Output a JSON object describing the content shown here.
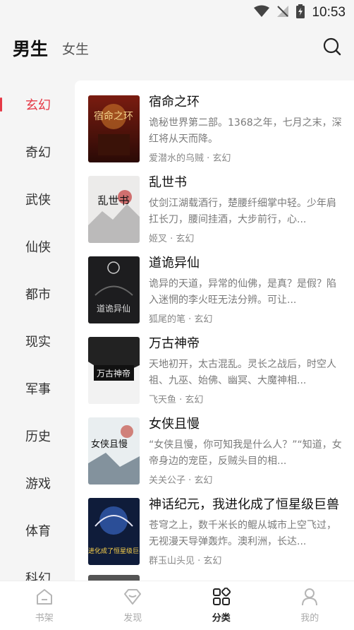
{
  "status_bar": {
    "time": "10:53"
  },
  "header": {
    "tab_active": "男生",
    "tab_inactive": "女生"
  },
  "sidebar": {
    "items": [
      {
        "label": "玄幻",
        "active": true
      },
      {
        "label": "奇幻"
      },
      {
        "label": "武侠"
      },
      {
        "label": "仙侠"
      },
      {
        "label": "都市"
      },
      {
        "label": "现实"
      },
      {
        "label": "军事"
      },
      {
        "label": "历史"
      },
      {
        "label": "游戏"
      },
      {
        "label": "体育"
      },
      {
        "label": "科幻"
      }
    ]
  },
  "books": [
    {
      "title": "宿命之环",
      "desc": "诡秘世界第二部。1368之年，七月之末，深红将从天而降。",
      "author": "爱潜水的乌贼",
      "genre": "玄幻",
      "cover_text": "宿命之环"
    },
    {
      "title": "乱世书",
      "desc": "仗剑江湖载酒行，楚腰纤细掌中轻。少年肩扛长刀，腰间挂酒，大步前行，心...",
      "author": "姬叉",
      "genre": "玄幻",
      "cover_text": "乱世书"
    },
    {
      "title": "道诡异仙",
      "desc": "诡异的天道，异常的仙佛，是真？是假？陷入迷惘的李火旺无法分辨。可让...",
      "author": "狐尾的笔",
      "genre": "玄幻",
      "cover_text": "道诡异仙"
    },
    {
      "title": "万古神帝",
      "desc": "天地初开，太古混乱。灵长之战后，时空人祖、九巫、始佛、幽冥、大魔神相...",
      "author": "飞天鱼",
      "genre": "玄幻",
      "cover_text": "万古神帝"
    },
    {
      "title": "女侠且慢",
      "desc": "“女侠且慢，你可知我是什么人？”“知道，女帝身边的宠臣，反贼头目的相...",
      "author": "关关公子",
      "genre": "玄幻",
      "cover_text": "女侠且慢"
    },
    {
      "title": "神话纪元，我进化成了恒星级巨兽",
      "desc": "苍穹之上，数千米长的鲲从城市上空飞过，无视漫天导弹轰炸。澳利洲，长达...",
      "author": "群玉山头见",
      "genre": "玄幻",
      "cover_text": "我进化成了恒星级巨兽"
    }
  ],
  "meta_separator": " · ",
  "bottom_nav": [
    {
      "label": "书架",
      "icon": "bookshelf-icon"
    },
    {
      "label": "发现",
      "icon": "discover-icon"
    },
    {
      "label": "分类",
      "icon": "category-icon",
      "active": true
    },
    {
      "label": "我的",
      "icon": "profile-icon"
    }
  ],
  "colors": {
    "accent": "#e53946",
    "background": "#f5f5f5"
  }
}
